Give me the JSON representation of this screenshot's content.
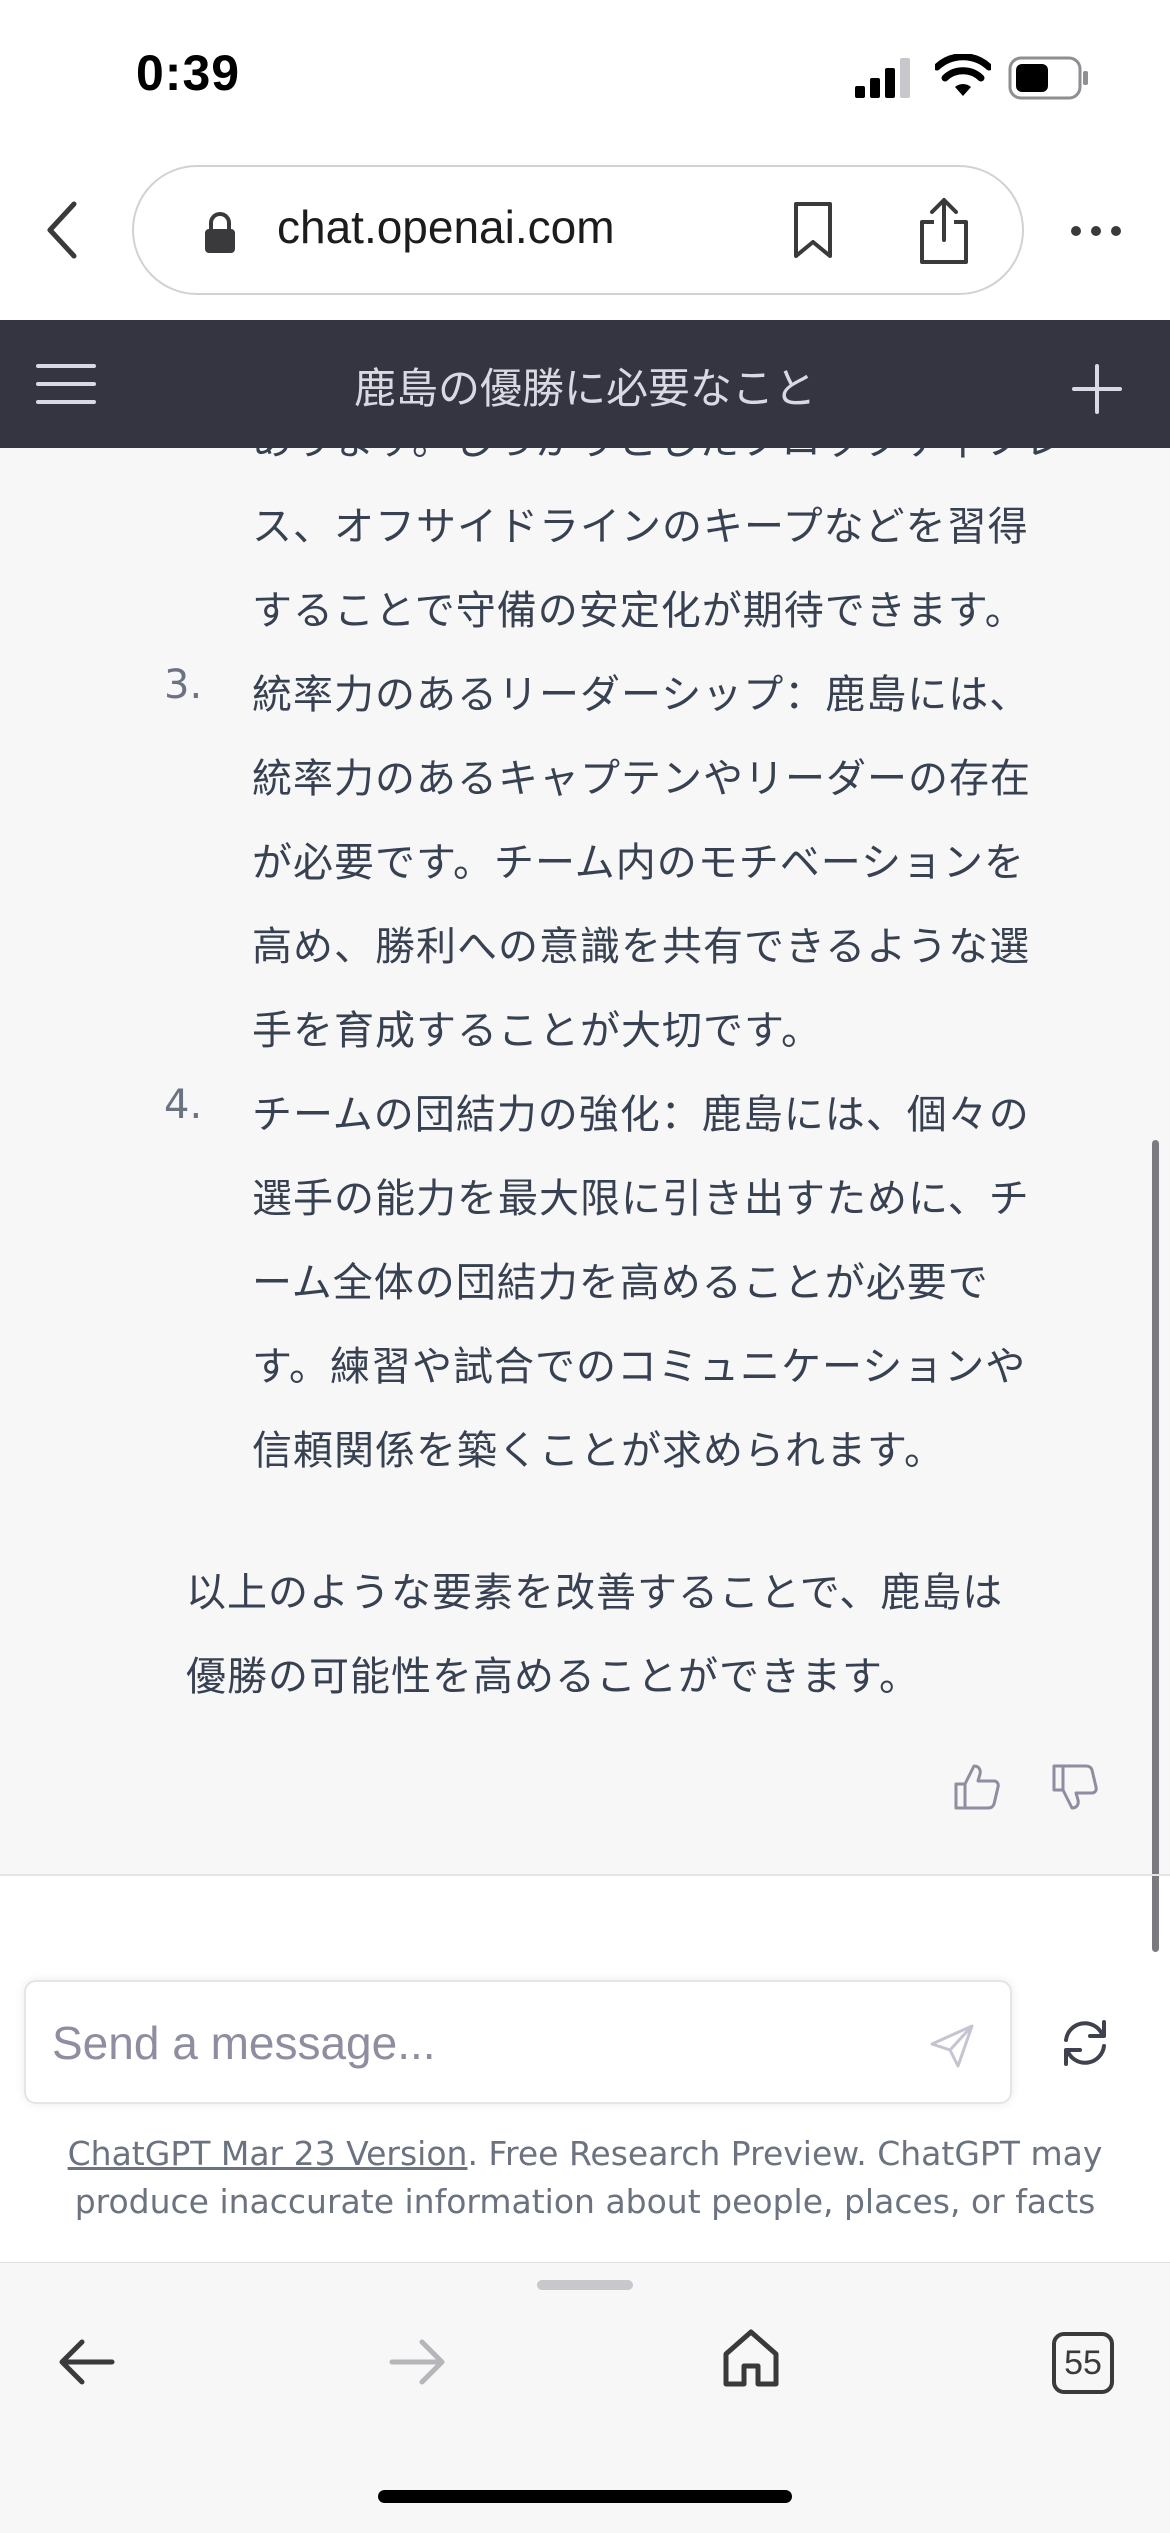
{
  "status_bar": {
    "time": "0:39"
  },
  "browser": {
    "url": "chat.openai.com",
    "tab_count": "55"
  },
  "header": {
    "title": "鹿島の優勝に必要なこと"
  },
  "message": {
    "partial_lines": [
      "あります。しっかりとしたプロックディフレ",
      "ス、オフサイドラインのキープなどを習得",
      "することで守備の安定化が期待できます。"
    ],
    "items": [
      {
        "number": "3.",
        "lines": [
          "統率力のあるリーダーシップ：鹿島には、",
          "統率力のあるキャプテンやリーダーの存在",
          "が必要です。チーム内のモチベーションを",
          "高め、勝利への意識を共有できるような選",
          "手を育成することが大切です。"
        ]
      },
      {
        "number": "4.",
        "lines": [
          "チームの団結力の強化：鹿島には、個々の",
          "選手の能力を最大限に引き出すために、チ",
          "ーム全体の団結力を高めることが必要で",
          "す。練習や試合でのコミュニケーションや",
          "信頼関係を築くことが求められます。"
        ]
      }
    ],
    "conclusion": [
      "以上のような要素を改善することで、鹿島は",
      "優勝の可能性を高めることができます。"
    ]
  },
  "input": {
    "placeholder": "Send a message..."
  },
  "footer": {
    "link_text": "ChatGPT Mar 23 Version",
    "text_line1": ". Free Research Preview. ChatGPT may",
    "text_line2": "produce inaccurate information about people, places, or facts"
  },
  "icons": {
    "back": "chevron-left-icon",
    "lock": "lock-icon",
    "bookmark": "bookmark-icon",
    "share": "share-icon",
    "more": "ellipsis-icon",
    "menu": "hamburger-icon",
    "new_chat": "plus-icon",
    "thumb_up": "thumbs-up-icon",
    "thumb_down": "thumbs-down-icon",
    "send": "send-icon",
    "regenerate": "refresh-icon",
    "home": "home-icon"
  },
  "colors": {
    "header_bg": "#343541",
    "chat_bg": "#f7f7f8",
    "text": "#374151",
    "muted": "#6b7280"
  }
}
